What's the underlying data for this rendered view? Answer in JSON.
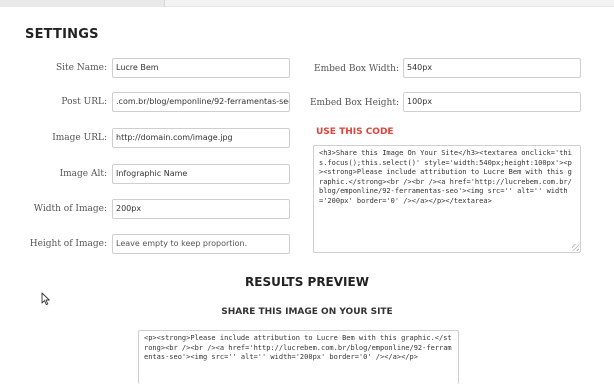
{
  "settings": {
    "title": "SETTINGS",
    "site_name": {
      "label": "Site Name:",
      "value": "Lucre Bem"
    },
    "post_url": {
      "label": "Post URL:",
      "value": ".com.br/blog/emponline/92-ferramentas-seo"
    },
    "image_url": {
      "label": "Image URL:",
      "value": "http://domain.com/image.jpg"
    },
    "image_alt": {
      "label": "Image Alt:",
      "value": "Infographic Name"
    },
    "width": {
      "label": "Width of Image:",
      "value": "200px"
    },
    "height": {
      "label": "Height of Image:",
      "placeholder": "Leave empty to keep proportion."
    },
    "embed_width": {
      "label": "Embed Box Width:",
      "value": "540px"
    },
    "embed_height": {
      "label": "Embed Box Height:",
      "value": "100px"
    }
  },
  "code": {
    "title": "USE THIS CODE",
    "text": "<h3>Share this Image On Your Site</h3><textarea onclick='this.focus();this.select()' style='width:540px;height:100px'><p><strong>Please include attribution to Lucre Bem with this graphic.</strong><br /><br /><a href='http://lucrebem.com.br/blog/emponline/92-ferramentas-seo'><img src='' alt='' width='200px' border='0' /></a></p></textarea>"
  },
  "results": {
    "title": "RESULTS PREVIEW",
    "share_title": "SHARE THIS IMAGE ON YOUR SITE",
    "preview_text": "<p><strong>Please include attribution to Lucre Bem with this graphic.</strong><br /><br /><a href='http://lucrebem.com.br/blog/emponline/92-ferramentas-seo'><img src='' alt='' width='200px' border='0' /></a></p>"
  },
  "colors": {
    "accent": "#e0433a"
  },
  "icons": {
    "cursor": "mouse-pointer-icon"
  }
}
